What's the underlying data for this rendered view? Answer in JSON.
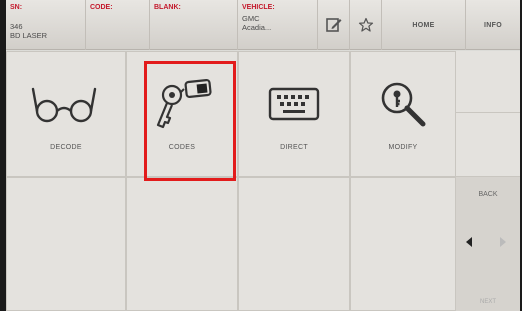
{
  "topbar": {
    "sn": {
      "label": "SN:",
      "value": "346\nBD LASER"
    },
    "code": {
      "label": "CODE:",
      "value": ""
    },
    "blank": {
      "label": "BLANK:",
      "value": ""
    },
    "vehicle": {
      "label": "VEHICLE:",
      "value": "GMC\nAcadia..."
    },
    "edit_icon": "edit-note-icon",
    "favorite_icon": "star-icon",
    "home_label": "HOME",
    "info_label": "INFO"
  },
  "menu": {
    "items": [
      {
        "label": "DECODE",
        "icon": "glasses-icon"
      },
      {
        "label": "CODES",
        "icon": "key-tag-icon",
        "selected": true
      },
      {
        "label": "DIRECT",
        "icon": "keyboard-icon"
      },
      {
        "label": "MODIFY",
        "icon": "magnifier-key-icon"
      }
    ]
  },
  "nav": {
    "back_label": "BACK",
    "next_label": "NEXT"
  },
  "colors": {
    "label_red": "#c4182b",
    "highlight": "#e21b1b",
    "background": "#dcdcd8"
  }
}
